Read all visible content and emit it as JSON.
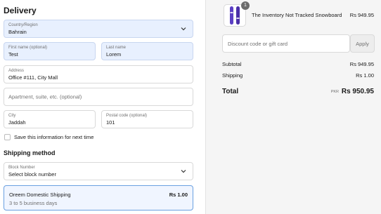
{
  "delivery": {
    "title": "Delivery",
    "country": {
      "label": "Country/Region",
      "value": "Bahrain"
    },
    "first_name": {
      "label": "First name (optional)",
      "value": "Test"
    },
    "last_name": {
      "label": "Last name",
      "value": "Lorem"
    },
    "address": {
      "label": "Address",
      "value": "Office #111, City Mall"
    },
    "apartment": {
      "placeholder": "Apartment, suite, etc. (optional)"
    },
    "city": {
      "label": "City",
      "value": "Jaddah"
    },
    "postal": {
      "label": "Postal code (optional)",
      "value": "101"
    },
    "save_info_label": "Save this information for next time"
  },
  "shipping": {
    "title": "Shipping method",
    "block": {
      "label": "Block Number",
      "value": "Select block number"
    },
    "option": {
      "name": "Oreem Domestic Shipping",
      "days": "3 to 5 business days",
      "price": "Rs 1.00"
    }
  },
  "summary": {
    "product": {
      "name": "The Inventory Not Tracked Snowboard",
      "price": "Rs 949.95",
      "quantity": "1"
    },
    "discount_placeholder": "Discount code or gift card",
    "apply_label": "Apply",
    "subtotal_label": "Subtotal",
    "subtotal_value": "Rs 949.95",
    "shipping_label": "Shipping",
    "shipping_value": "Rs 1.00",
    "total_label": "Total",
    "currency": "PKR",
    "total_value": "Rs 950.95"
  },
  "colors": {
    "autofill": "#e8f0fe",
    "selected_border": "#6aa0e0",
    "summary_bg": "#f5f5f5",
    "snowboard": "#5b3fc4"
  }
}
